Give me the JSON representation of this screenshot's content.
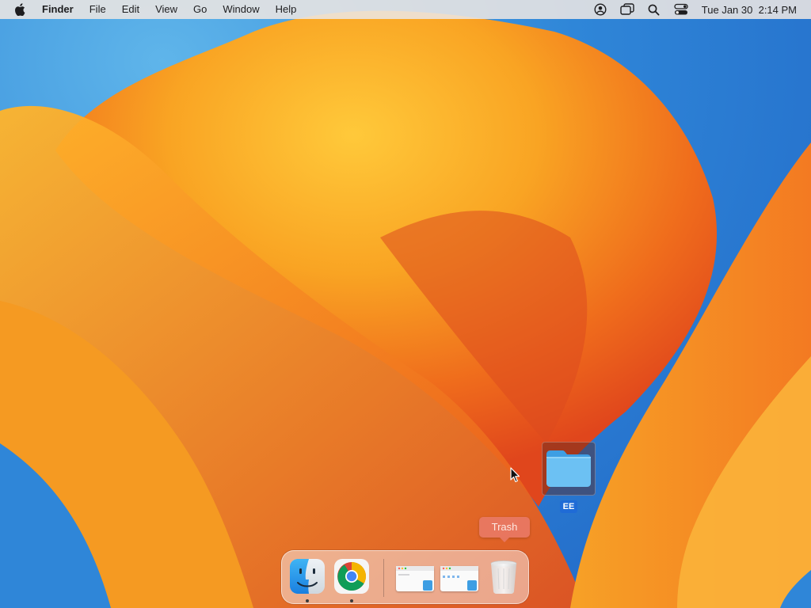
{
  "menubar": {
    "apple_icon": "apple-logo-icon",
    "app_name": "Finder",
    "menus": [
      "File",
      "Edit",
      "View",
      "Go",
      "Window",
      "Help"
    ],
    "status_icons": [
      "user-account-icon",
      "screen-mirroring-icon",
      "spotlight-search-icon",
      "control-center-icon"
    ],
    "clock": "Tue Jan 30  2:14 PM"
  },
  "desktop": {
    "folder": {
      "icon": "folder-icon",
      "label": "EE",
      "selected": true,
      "color": "#5fb8ef"
    }
  },
  "tooltip": {
    "text": "Trash"
  },
  "dock": {
    "apps": [
      {
        "name": "Finder",
        "icon": "finder-icon",
        "running": true
      },
      {
        "name": "Google Chrome",
        "icon": "chrome-icon",
        "running": true
      }
    ],
    "minimized_windows": [
      {
        "icon": "finder-window-thumbnail-icon"
      },
      {
        "icon": "finder-window-thumbnail-icon"
      }
    ],
    "trash": {
      "icon": "trash-icon"
    }
  },
  "colors": {
    "wallpaper_orange": "#f59a1e",
    "wallpaper_blue": "#2f86d8",
    "selection_blue": "#1f6bd6"
  }
}
